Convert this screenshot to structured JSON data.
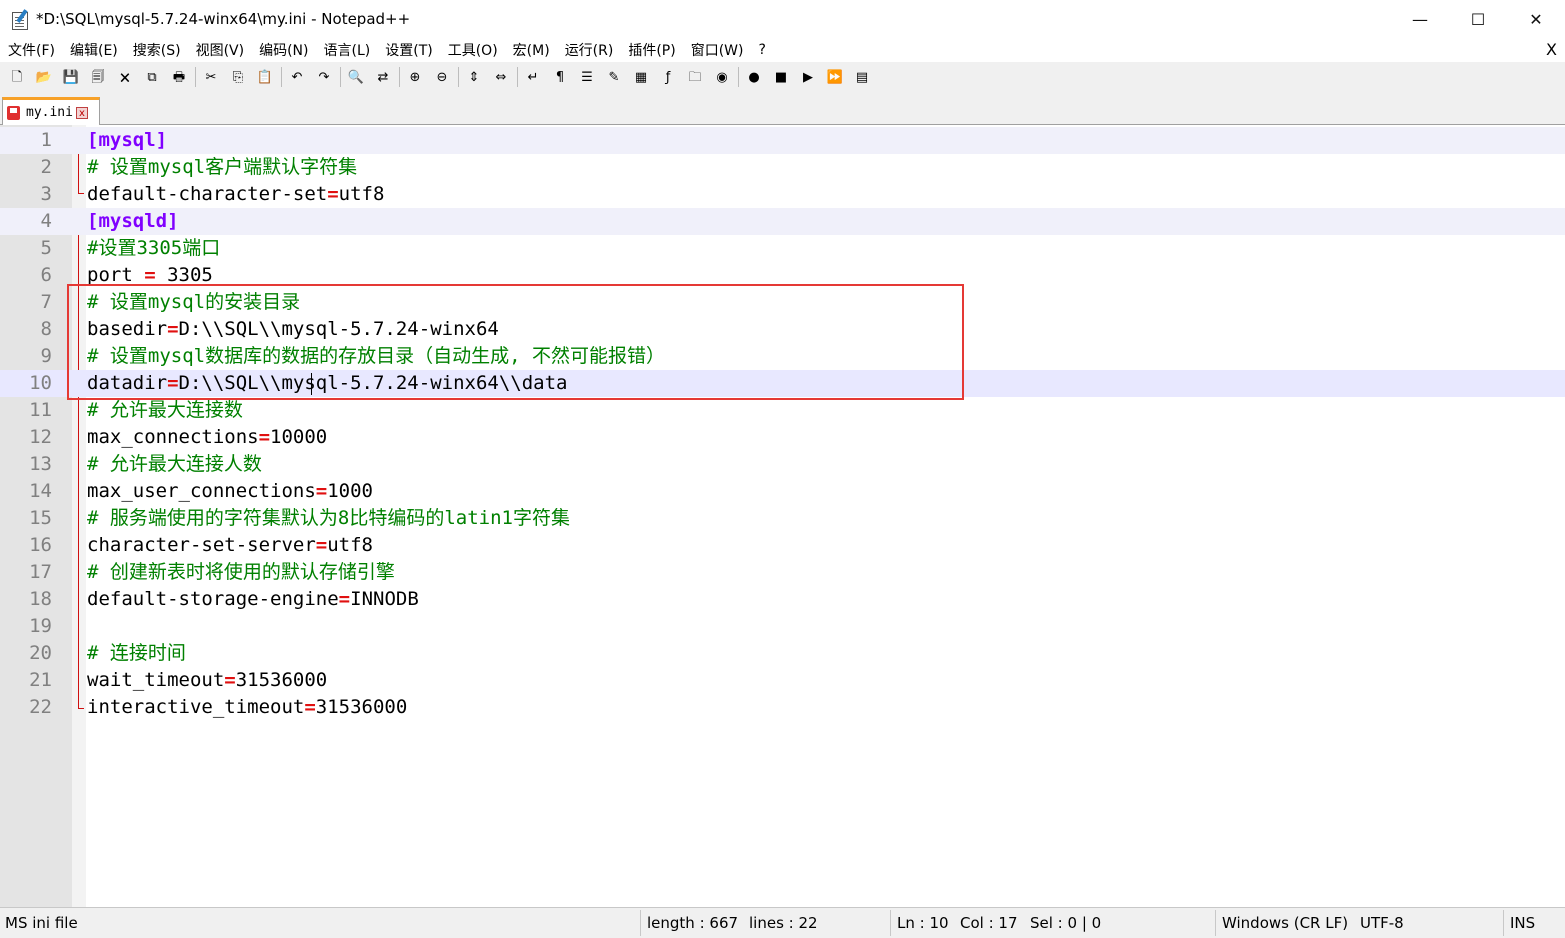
{
  "window": {
    "title": "*D:\\SQL\\mysql-5.7.24-winx64\\my.ini - Notepad++",
    "minimize": "—",
    "maximize": "☐",
    "close": "✕"
  },
  "menu": {
    "items": [
      "文件(F)",
      "编辑(E)",
      "搜索(S)",
      "视图(V)",
      "编码(N)",
      "语言(L)",
      "设置(T)",
      "工具(O)",
      "宏(M)",
      "运行(R)",
      "插件(P)",
      "窗口(W)",
      "?"
    ],
    "close": "X"
  },
  "toolbar": {
    "icons": [
      "new-file-icon",
      "open-file-icon",
      "save-icon",
      "save-all-icon",
      "close-icon",
      "close-all-icon",
      "print-icon",
      "|",
      "cut-icon",
      "copy-icon",
      "paste-icon",
      "|",
      "undo-icon",
      "redo-icon",
      "|",
      "find-icon",
      "replace-icon",
      "|",
      "zoom-in-icon",
      "zoom-out-icon",
      "|",
      "sync-vertical-icon",
      "sync-horizontal-icon",
      "|",
      "word-wrap-icon",
      "show-all-chars-icon",
      "indent-guide-icon",
      "user-language-icon",
      "document-map-icon",
      "function-list-icon",
      "folder-workspace-icon",
      "monitoring-icon",
      "|",
      "record-macro-icon",
      "stop-macro-icon",
      "play-macro-icon",
      "run-macro-multiple-icon",
      "save-macro-icon"
    ],
    "glyphs": {
      "new-file-icon": "🗋",
      "open-file-icon": "📂",
      "save-icon": "💾",
      "save-all-icon": "🗐",
      "close-icon": "🗙",
      "close-all-icon": "⧉",
      "print-icon": "🖶",
      "cut-icon": "✂",
      "copy-icon": "⎘",
      "paste-icon": "📋",
      "undo-icon": "↶",
      "redo-icon": "↷",
      "find-icon": "🔍",
      "replace-icon": "⇄",
      "zoom-in-icon": "⊕",
      "zoom-out-icon": "⊖",
      "sync-vertical-icon": "⇕",
      "sync-horizontal-icon": "⇔",
      "word-wrap-icon": "↵",
      "show-all-chars-icon": "¶",
      "indent-guide-icon": "☰",
      "user-language-icon": "✎",
      "document-map-icon": "▦",
      "function-list-icon": "ƒ",
      "folder-workspace-icon": "🗀",
      "monitoring-icon": "◉",
      "record-macro-icon": "●",
      "stop-macro-icon": "■",
      "play-macro-icon": "▶",
      "run-macro-multiple-icon": "⏩",
      "save-macro-icon": "▤"
    }
  },
  "tab": {
    "label": "my.ini",
    "close": "x"
  },
  "editor": {
    "lines": [
      {
        "n": "1",
        "parts": [
          [
            "sec",
            "[mysql]"
          ]
        ]
      },
      {
        "n": "2",
        "parts": [
          [
            "cmt",
            "# 设置mysql客户端默认字符集"
          ]
        ]
      },
      {
        "n": "3",
        "parts": [
          [
            "txt",
            "default-character-set"
          ],
          [
            "eq",
            "="
          ],
          [
            "txt",
            "utf8"
          ]
        ]
      },
      {
        "n": "4",
        "parts": [
          [
            "sec",
            "[mysqld]"
          ]
        ]
      },
      {
        "n": "5",
        "parts": [
          [
            "cmt",
            "#设置3305端口"
          ]
        ]
      },
      {
        "n": "6",
        "parts": [
          [
            "txt",
            "port "
          ],
          [
            "eq",
            "="
          ],
          [
            "txt",
            " 3305"
          ]
        ]
      },
      {
        "n": "7",
        "parts": [
          [
            "cmt",
            "# 设置mysql的安装目录"
          ]
        ]
      },
      {
        "n": "8",
        "parts": [
          [
            "txt",
            "basedir"
          ],
          [
            "eq",
            "="
          ],
          [
            "txt",
            "D:\\\\SQL\\\\mysql-5.7.24-winx64"
          ]
        ]
      },
      {
        "n": "9",
        "parts": [
          [
            "cmt",
            "# 设置mysql数据库的数据的存放目录（自动生成, 不然可能报错）"
          ]
        ]
      },
      {
        "n": "10",
        "parts": [
          [
            "txt",
            "datadir"
          ],
          [
            "eq",
            "="
          ],
          [
            "txt",
            "D:\\\\SQL\\\\mysql-5.7.24-winx64\\\\data"
          ]
        ]
      },
      {
        "n": "11",
        "parts": [
          [
            "cmt",
            "# 允许最大连接数"
          ]
        ]
      },
      {
        "n": "12",
        "parts": [
          [
            "txt",
            "max_connections"
          ],
          [
            "eq",
            "="
          ],
          [
            "txt",
            "10000"
          ]
        ]
      },
      {
        "n": "13",
        "parts": [
          [
            "cmt",
            "# 允许最大连接人数"
          ]
        ]
      },
      {
        "n": "14",
        "parts": [
          [
            "txt",
            "max_user_connections"
          ],
          [
            "eq",
            "="
          ],
          [
            "txt",
            "1000"
          ]
        ]
      },
      {
        "n": "15",
        "parts": [
          [
            "cmt",
            "# 服务端使用的字符集默认为8比特编码的latin1字符集"
          ]
        ]
      },
      {
        "n": "16",
        "parts": [
          [
            "txt",
            "character-set-server"
          ],
          [
            "eq",
            "="
          ],
          [
            "txt",
            "utf8"
          ]
        ]
      },
      {
        "n": "17",
        "parts": [
          [
            "cmt",
            "# 创建新表时将使用的默认存储引擎"
          ]
        ]
      },
      {
        "n": "18",
        "parts": [
          [
            "txt",
            "default-storage-engine"
          ],
          [
            "eq",
            "="
          ],
          [
            "txt",
            "INNODB"
          ]
        ]
      },
      {
        "n": "19",
        "parts": []
      },
      {
        "n": "20",
        "parts": [
          [
            "cmt",
            "# 连接时间"
          ]
        ]
      },
      {
        "n": "21",
        "parts": [
          [
            "txt",
            "wait_timeout"
          ],
          [
            "eq",
            "="
          ],
          [
            "txt",
            "31536000"
          ]
        ]
      },
      {
        "n": "22",
        "parts": [
          [
            "txt",
            "interactive_timeout"
          ],
          [
            "eq",
            "="
          ],
          [
            "txt",
            "31536000"
          ]
        ]
      }
    ],
    "active_line": "10"
  },
  "status": {
    "file_type": "MS ini file",
    "length": "length : 667",
    "lines": "lines : 22",
    "ln": "Ln : 10",
    "col": "Col : 17",
    "sel": "Sel : 0 | 0",
    "eol": "Windows (CR LF)",
    "encoding": "UTF-8",
    "mode": "INS"
  }
}
